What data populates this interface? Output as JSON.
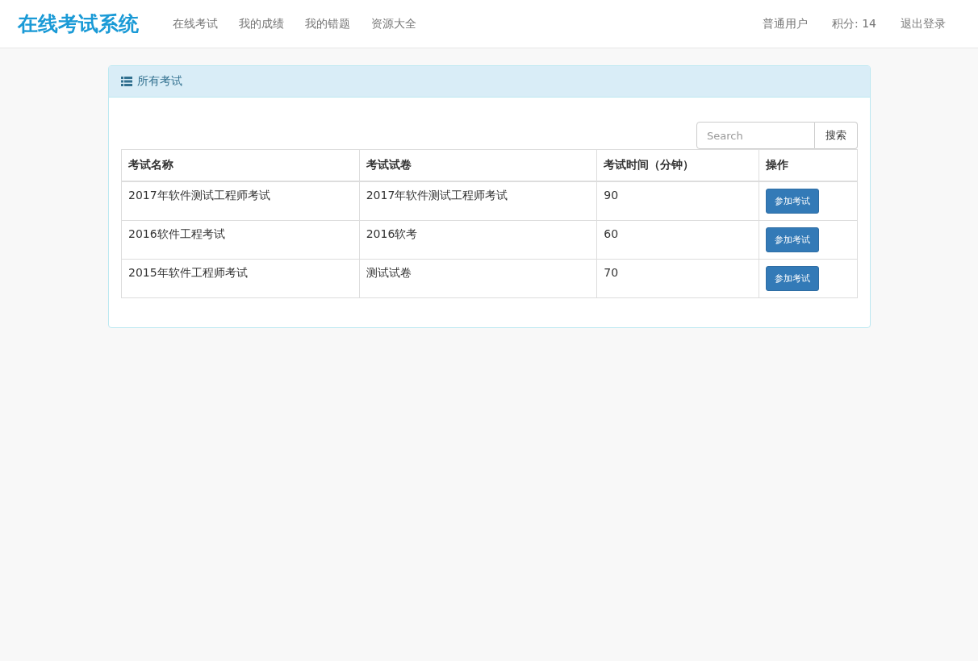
{
  "brand": "在线考试系统",
  "nav": [
    {
      "label": "在线考试"
    },
    {
      "label": "我的成绩"
    },
    {
      "label": "我的错题"
    },
    {
      "label": "资源大全"
    }
  ],
  "user": {
    "role": "普通用户",
    "points_label": "积分:",
    "points": "14",
    "logout": "退出登录"
  },
  "panel": {
    "title": "所有考试"
  },
  "search": {
    "placeholder": "Search",
    "button": "搜索"
  },
  "table": {
    "columns": [
      "考试名称",
      "考试试卷",
      "考试时间（分钟）",
      "操作"
    ],
    "rows": [
      {
        "name": "2017年软件测试工程师考试",
        "paper": "2017年软件测试工程师考试",
        "time": "90",
        "action": "参加考试"
      },
      {
        "name": "2016软件工程考试",
        "paper": "2016软考",
        "time": "60",
        "action": "参加考试"
      },
      {
        "name": "2015年软件工程师考试",
        "paper": "测试试卷",
        "time": "70",
        "action": "参加考试"
      }
    ]
  }
}
